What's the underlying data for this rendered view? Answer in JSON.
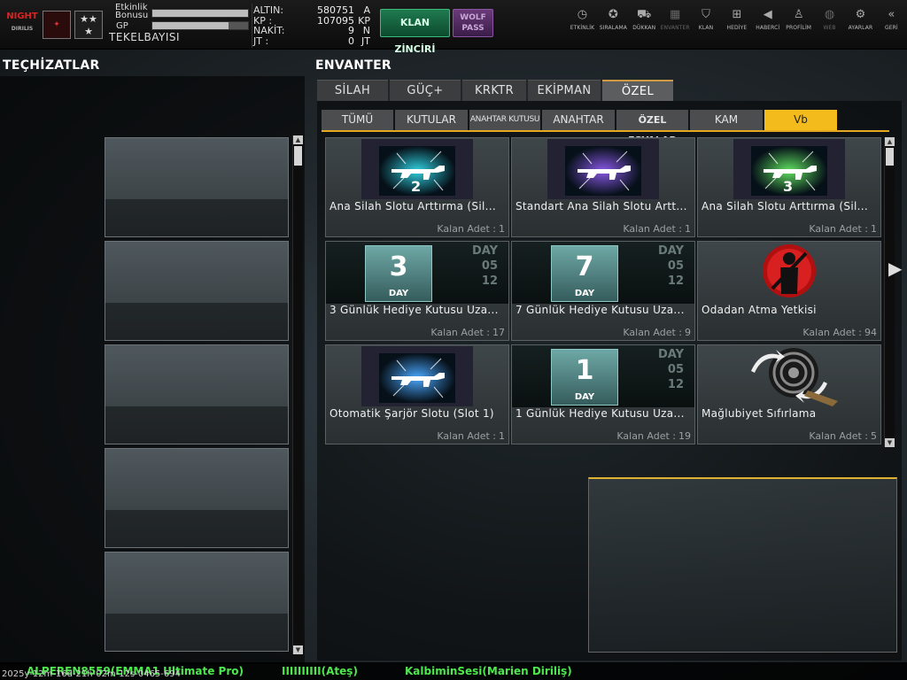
{
  "player": {
    "bonus_label": "Etkinlik Bonusu",
    "gp_label": "GP",
    "bonus_fill": 1.0,
    "gp_fill": 0.8,
    "nickname": "TEKELBAYISI",
    "logo_text": "NIGHT",
    "logo_sub": "DIRILIS"
  },
  "currency": [
    {
      "key": "ALTIN:",
      "value": "580751",
      "unit": "A"
    },
    {
      "key": "KP  :",
      "value": "107095",
      "unit": "KP"
    },
    {
      "key": "NAKİT:",
      "value": "9",
      "unit": "N"
    },
    {
      "key": "JT   :",
      "value": "0",
      "unit": "JT"
    }
  ],
  "buttons": {
    "klan_chain": "KLAN ZİNCİRİ",
    "wolf_pass": "WOLF PASS"
  },
  "top_menu": [
    {
      "label": "ETKİNLİK",
      "icon": "stopwatch-icon",
      "glyph": "◷",
      "dim": false
    },
    {
      "label": "SIRALAMA",
      "icon": "medal-icon",
      "glyph": "✪",
      "dim": false
    },
    {
      "label": "DÜKKAN",
      "icon": "cart-icon",
      "glyph": "⛟",
      "dim": false
    },
    {
      "label": "ENVANTER",
      "icon": "inventory-icon",
      "glyph": "▦",
      "dim": true
    },
    {
      "label": "KLAN",
      "icon": "shield-icon",
      "glyph": "⛉",
      "dim": false
    },
    {
      "label": "HEDİYE",
      "icon": "gift-icon",
      "glyph": "⊞",
      "dim": false
    },
    {
      "label": "HABERCİ",
      "icon": "megaphone-icon",
      "glyph": "◀",
      "dim": false
    },
    {
      "label": "PROFİLİM",
      "icon": "profile-icon",
      "glyph": "♙",
      "dim": false
    },
    {
      "label": "WEB",
      "icon": "globe-icon",
      "glyph": "◍",
      "dim": true
    },
    {
      "label": "AYARLAR",
      "icon": "gear-icon",
      "glyph": "⚙",
      "dim": false
    },
    {
      "label": "GERİ",
      "icon": "back-icon",
      "glyph": "«",
      "dim": false
    }
  ],
  "sections": {
    "equipment_title": "TEÇHİZATLAR",
    "inventory_title": "ENVANTER"
  },
  "tabs": [
    {
      "label": "SİLAH",
      "active": false
    },
    {
      "label": "GÜÇ+",
      "active": false
    },
    {
      "label": "KRKTR",
      "active": false
    },
    {
      "label": "EKİPMAN",
      "active": false
    },
    {
      "label": "ÖZEL",
      "active": true
    }
  ],
  "subtabs": [
    {
      "label": "TÜMÜ",
      "style": "",
      "active": false
    },
    {
      "label": "KUTULAR",
      "style": "",
      "active": false
    },
    {
      "label": "ANAHTAR KUTUSU",
      "style": "small",
      "active": false
    },
    {
      "label": "ANAHTAR",
      "style": "",
      "active": false
    },
    {
      "label": "ÖZEL EŞYALAR",
      "style": "bold",
      "active": false
    },
    {
      "label": "KAM",
      "style": "",
      "active": false
    },
    {
      "label": "Vb",
      "style": "",
      "active": true
    }
  ],
  "items": [
    {
      "name": "Ana Silah Slotu Arttırma (Sil...",
      "count_label": "Kalan Adet :",
      "count": "1",
      "art": "cage",
      "tone": "#2fd0e0",
      "digit": "2"
    },
    {
      "name": "Standart Ana Silah Slotu Artt...",
      "count_label": "Kalan Adet :",
      "count": "1",
      "art": "cage",
      "tone": "#8a58e8",
      "digit": ""
    },
    {
      "name": "Ana Silah Slotu Arttırma (Sil...",
      "count_label": "Kalan Adet :",
      "count": "1",
      "art": "cage",
      "tone": "#5fe05f",
      "digit": "3"
    },
    {
      "name": "3 Günlük Hediye Kutusu Uza...",
      "count_label": "Kalan Adet :",
      "count": "17",
      "art": "day",
      "digit": "3"
    },
    {
      "name": "7 Günlük Hediye Kutusu Uza...",
      "count_label": "Kalan Adet :",
      "count": "9",
      "art": "day",
      "digit": "7"
    },
    {
      "name": "Odadan Atma Yetkisi",
      "count_label": "Kalan Adet :",
      "count": "94",
      "art": "kick"
    },
    {
      "name": "Otomatik Şarjör Slotu (Slot 1)",
      "count_label": "Kalan Adet :",
      "count": "1",
      "art": "cage",
      "tone": "#4aa8ff",
      "digit": ""
    },
    {
      "name": "1 Günlük Hediye Kutusu Uza...",
      "count_label": "Kalan Adet :",
      "count": "19",
      "art": "day",
      "digit": "1"
    },
    {
      "name": "Mağlubiyet  Sıfırlama",
      "count_label": "Kalan Adet :",
      "count": "5",
      "art": "target"
    }
  ],
  "day_art": {
    "day_word": "DAY",
    "side_a": "05",
    "side_b": "12"
  },
  "ticker": [
    "ALPEREN8559(EMMA1 Ultimate Pro)",
    "IIIIIIIIII(Ateş)",
    "KalbiminSesi(Marien Diriliş)"
  ],
  "timestamp": "2025y-12m-16d-21h-02m-12s-0465-694"
}
